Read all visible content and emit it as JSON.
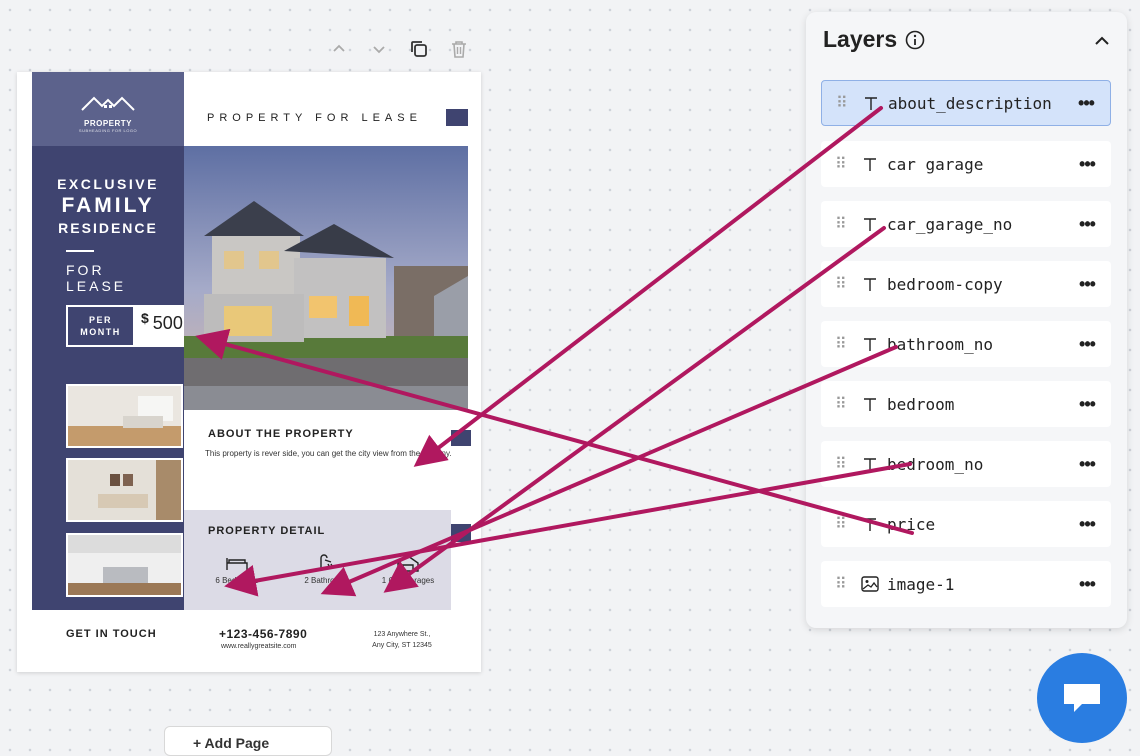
{
  "flyer": {
    "logo": {
      "name": "PROPERTY",
      "sub": "SUBHEADING FOR LOGO"
    },
    "headline": {
      "line1": "EXCLUSIVE",
      "line2": "FAMILY",
      "line3": "RESIDENCE"
    },
    "for_lease": {
      "line1": "FOR",
      "line2": "LEASE"
    },
    "price_label": {
      "line1": "PER",
      "line2": "MONTH"
    },
    "price_currency": "$",
    "price_value": "500",
    "title": "PROPERTY FOR LEASE",
    "about_title": "ABOUT THE PROPERTY",
    "about_desc": "This property is rever side, you can get the city view from the balcony.",
    "detail_title": "PROPERTY DETAIL",
    "features": [
      {
        "label": "6 Bedrooms",
        "icon": "bed-icon"
      },
      {
        "label": "2 Bathrooms",
        "icon": "shower-icon"
      },
      {
        "label": "1 Car Garages",
        "icon": "garage-icon"
      }
    ],
    "contact": {
      "get_in_touch": "GET IN TOUCH",
      "phone": "+123-456-7890",
      "website": "www.reallygreatsite.com",
      "address_line1": "123 Anywhere St.,",
      "address_line2": "Any City, ST 12345"
    }
  },
  "layers_panel": {
    "title": "Layers",
    "items": [
      {
        "name": "about_description",
        "type": "text",
        "selected": true
      },
      {
        "name": "car garage",
        "type": "text"
      },
      {
        "name": "car_garage_no",
        "type": "text"
      },
      {
        "name": "bedroom-copy",
        "type": "text"
      },
      {
        "name": "bathroom_no",
        "type": "text"
      },
      {
        "name": "bedroom",
        "type": "text"
      },
      {
        "name": "bedroom_no",
        "type": "text"
      },
      {
        "name": "price",
        "type": "text"
      },
      {
        "name": "image-1",
        "type": "image"
      }
    ]
  },
  "add_page": {
    "label": "+ Add Page"
  },
  "colors": {
    "navy": "#3f4470",
    "arrow": "#b0185f",
    "accent_blue": "#2a7de1",
    "selected_row": "#d4e3fa"
  }
}
